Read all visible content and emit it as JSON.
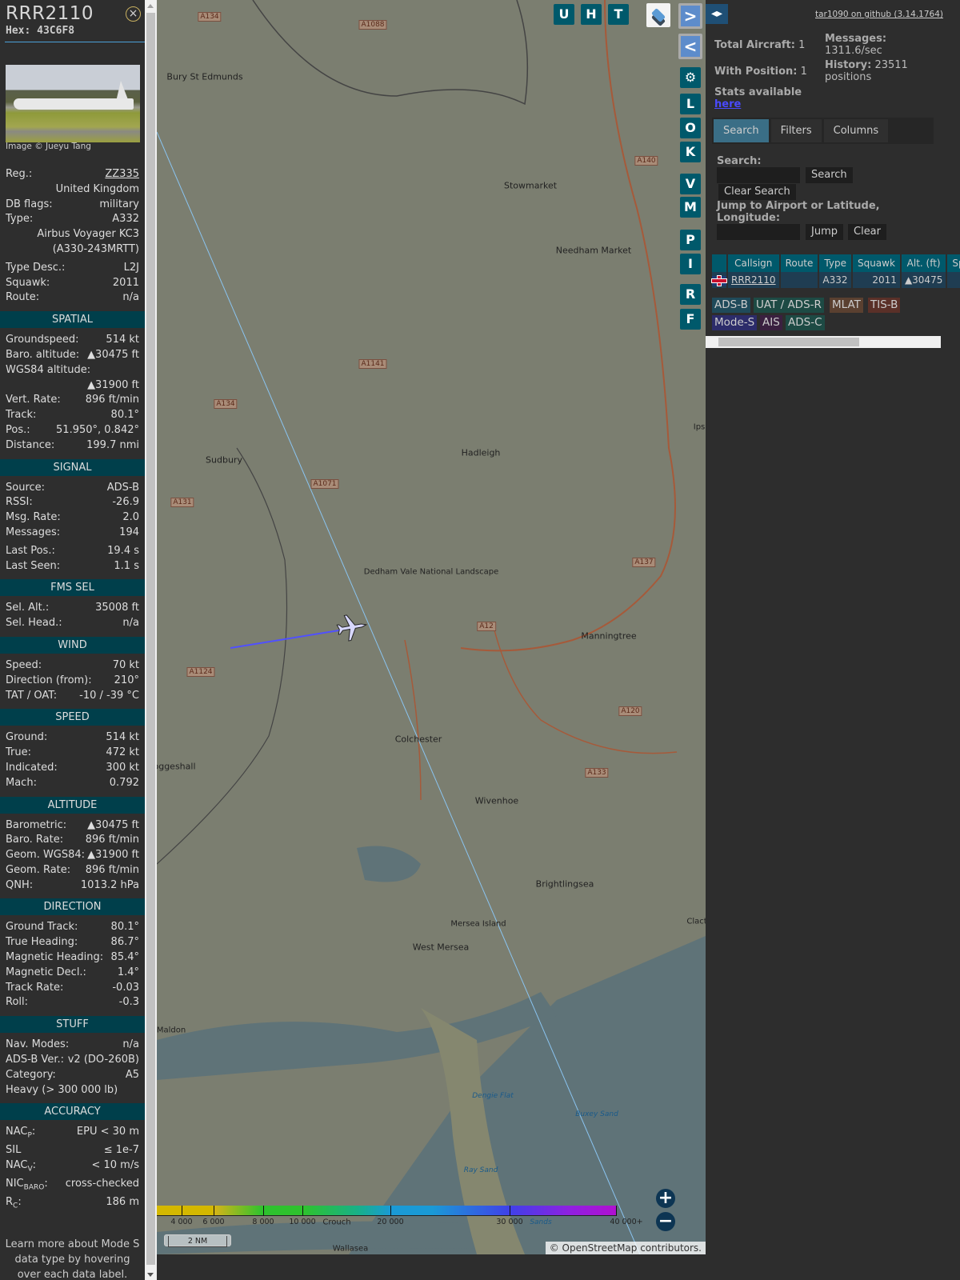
{
  "infoblock": {
    "callsign": "RRR2110",
    "hex": "Hex: 43C6F8",
    "close_icon": "×",
    "photo_credit": "Image © Jueyu Tang",
    "groups": [
      {
        "title": null,
        "rows": [
          {
            "label": "Reg.:",
            "value": "ZZ335",
            "link": true
          },
          {
            "label": "",
            "value": "United Kingdom"
          },
          {
            "label": "DB flags:",
            "value": "military"
          },
          {
            "label": "Type:",
            "value": "A332"
          },
          {
            "label": "",
            "value": "Airbus Voyager KC3"
          },
          {
            "label": "",
            "value": "(A330-243MRTT)"
          },
          {
            "label": "Type Desc.:",
            "value": "L2J",
            "gap": true
          },
          {
            "label": "Squawk:",
            "value": "2011"
          },
          {
            "label": "Route:",
            "value": "n/a"
          }
        ]
      },
      {
        "title": "SPATIAL",
        "rows": [
          {
            "label": "Groundspeed:",
            "value": "514 kt"
          },
          {
            "label": "Baro. altitude:",
            "value": "▲30475 ft"
          },
          {
            "label": "WGS84 altitude:",
            "value": ""
          },
          {
            "label": "",
            "value": "▲31900 ft"
          },
          {
            "label": "Vert. Rate:",
            "value": "896 ft/min"
          },
          {
            "label": "Track:",
            "value": "80.1°"
          },
          {
            "label": "Pos.:",
            "value": "51.950°, 0.842°"
          },
          {
            "label": "Distance:",
            "value": "199.7 nmi"
          }
        ]
      },
      {
        "title": "SIGNAL",
        "rows": [
          {
            "label": "Source:",
            "value": "ADS-B"
          },
          {
            "label": "RSSI:",
            "value": "-26.9"
          },
          {
            "label": "Msg. Rate:",
            "value": "2.0"
          },
          {
            "label": "Messages:",
            "value": "194"
          },
          {
            "label": "Last Pos.:",
            "value": "19.4 s",
            "gap": true
          },
          {
            "label": "Last Seen:",
            "value": "1.1 s"
          }
        ]
      },
      {
        "title": "FMS SEL",
        "rows": [
          {
            "label": "Sel. Alt.:",
            "value": "35008 ft"
          },
          {
            "label": "Sel. Head.:",
            "value": "n/a"
          }
        ]
      },
      {
        "title": "WIND",
        "rows": [
          {
            "label": "Speed:",
            "value": "70 kt"
          },
          {
            "label": "Direction (from):",
            "value": "210°"
          },
          {
            "label": "TAT / OAT:",
            "value": "-10 / -39 °C"
          }
        ]
      },
      {
        "title": "SPEED",
        "rows": [
          {
            "label": "Ground:",
            "value": "514 kt"
          },
          {
            "label": "True:",
            "value": "472 kt"
          },
          {
            "label": "Indicated:",
            "value": "300 kt"
          },
          {
            "label": "Mach:",
            "value": "0.792"
          }
        ]
      },
      {
        "title": "ALTITUDE",
        "rows": [
          {
            "label": "Barometric:",
            "value": "▲30475 ft"
          },
          {
            "label": "Baro. Rate:",
            "value": "896 ft/min"
          },
          {
            "label": "Geom. WGS84:",
            "value": "▲31900 ft"
          },
          {
            "label": "Geom. Rate:",
            "value": "896 ft/min"
          },
          {
            "label": "QNH:",
            "value": "1013.2 hPa"
          }
        ]
      },
      {
        "title": "DIRECTION",
        "rows": [
          {
            "label": "Ground Track:",
            "value": "80.1°"
          },
          {
            "label": "True Heading:",
            "value": "86.7°"
          },
          {
            "label": "Magnetic Heading:",
            "value": "85.4°"
          },
          {
            "label": "Magnetic Decl.:",
            "value": "1.4°"
          },
          {
            "label": "Track Rate:",
            "value": "-0.03"
          },
          {
            "label": "Roll:",
            "value": "-0.3"
          }
        ]
      },
      {
        "title": "STUFF",
        "rows": [
          {
            "label": "Nav. Modes:",
            "value": "n/a"
          },
          {
            "label": "ADS-B Ver.:",
            "value": "v2 (DO-260B)"
          },
          {
            "label": "Category:",
            "value": "A5"
          },
          {
            "label": "Heavy (> 300 000 lb)",
            "value": ""
          }
        ]
      },
      {
        "title": "ACCURACY",
        "rows": [
          {
            "label": "NAC",
            "sub": "P",
            "value": "EPU < 30 m",
            "gap": true
          },
          {
            "label": "SIL",
            "value": "≤ 1e-7",
            "gap": true
          },
          {
            "label": "NAC",
            "sub": "V",
            "value": "< 10 m/s"
          },
          {
            "label": "NIC",
            "sub": "BARO",
            "value": "cross-checked",
            "gap": true
          },
          {
            "label": "R",
            "sub": "C",
            "value": "186 m",
            "gap": true
          }
        ]
      }
    ],
    "footer": "Learn more about Mode S data type by hovering over each data label."
  },
  "map": {
    "top_buttons": [
      "U",
      "H",
      "T"
    ],
    "side_buttons": [
      ">",
      "<",
      "⚙",
      "L",
      "O",
      "K",
      "V",
      "M",
      "P",
      "I",
      "R",
      "F"
    ],
    "zoom_in": "+",
    "zoom_out": "−",
    "scale": "2 NM",
    "attribution": "© OpenStreetMap contributors.",
    "altitude_legend": [
      "4 000",
      "6 000",
      "8 000",
      "10 000",
      "20 000",
      "30 000",
      "40 000+"
    ],
    "places": [
      "Bury St Edmunds",
      "Stowmarket",
      "Needham Market",
      "Sudbury",
      "Hadleigh",
      "Dedham Vale National Landscape",
      "Manningtree",
      "Colchester",
      "Wivenhoe",
      "Brightlingsea",
      "Mersea Island",
      "West Mersea",
      "Maldon",
      "oggeshall",
      "Dengie Flat",
      "Buxey Sand",
      "Ray Sand",
      "Crouch",
      "Sands",
      "Wallasea",
      "Clact",
      "Ips"
    ],
    "roads": [
      "A134",
      "A1088",
      "A140",
      "A1141",
      "A134",
      "A1071",
      "A131",
      "A137",
      "A12",
      "A1124",
      "A120",
      "A133"
    ]
  },
  "panel": {
    "toggle": "◂▸",
    "github": "tar1090 on github (3.14.1764)",
    "total_aircraft": "Total Aircraft:",
    "total_aircraft_value": "1",
    "with_position": "With Position:",
    "with_position_value": "1",
    "messages": "Messages:",
    "messages_value": "1311.6/sec",
    "history": "History:",
    "history_value": "23511 positions",
    "stats": "Stats available",
    "stats_link": "here",
    "tabs": [
      "Search",
      "Filters",
      "Columns"
    ],
    "search_label": "Search:",
    "search_button": "Search",
    "clear_search": "Clear Search",
    "jump_label": "Jump to Airport or Latitude, Longitude:",
    "jump_button": "Jump",
    "clear_button": "Clear",
    "table": {
      "columns": [
        "",
        "Callsign",
        "Route",
        "Type",
        "Squawk",
        "Alt. (ft)",
        "Sp"
      ],
      "rows": [
        {
          "callsign": "RRR2110",
          "route": "",
          "type": "A332",
          "squawk": "2011",
          "alt": "▲30475"
        }
      ]
    },
    "sources": [
      {
        "name": "ADS-B",
        "color": "#1f4a5a"
      },
      {
        "name": "UAT / ADS-R",
        "color": "#1d4a44"
      },
      {
        "name": "MLAT",
        "color": "#5a4030"
      },
      {
        "name": "TIS-B",
        "color": "#5a3028"
      },
      {
        "name": "Mode-S",
        "color": "#2c2c6a"
      },
      {
        "name": "AIS",
        "color": "#3a2040"
      },
      {
        "name": "ADS-C",
        "color": "#1d4a44"
      }
    ]
  }
}
